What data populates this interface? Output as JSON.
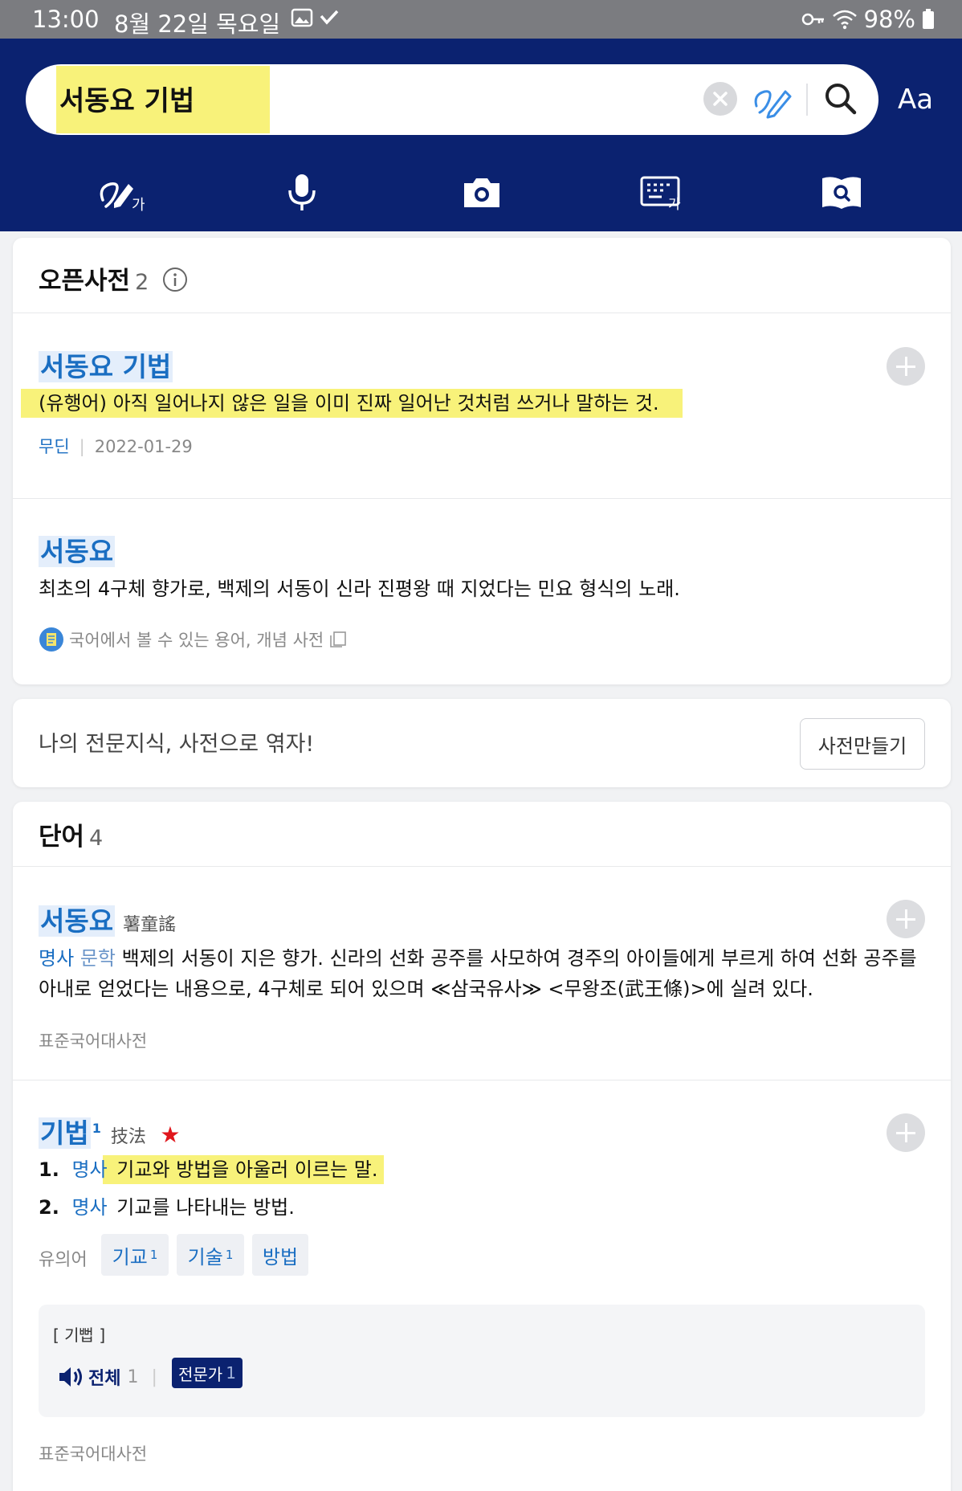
{
  "status_bar": {
    "time": "13:00",
    "date": "8월 22일 목요일",
    "battery": "98%"
  },
  "search": {
    "query": "서동요 기법",
    "font_button": "Aa"
  },
  "tools": [
    "handwriting-icon",
    "microphone-icon",
    "camera-icon",
    "keyboard-icon",
    "book-search-icon"
  ],
  "open_dict": {
    "title": "오픈사전",
    "count": "2",
    "entries": [
      {
        "title": "서동요 기법",
        "definition": "(유행어) 아직 일어나지 않은 일을 이미 진짜 일어난 것처럼 쓰거나 말하는 것.",
        "author": "무딘",
        "date": "2022-01-29"
      },
      {
        "title": "서동요",
        "definition": "최초의 4구체 향가로, 백제의 서동이 신라 진평왕 때 지었다는 민요 형식의 노래.",
        "source": "국어에서 볼 수 있는 용어, 개념 사전"
      }
    ]
  },
  "promo": {
    "text": "나의 전문지식, 사전으로 엮자!",
    "button": "사전만들기"
  },
  "words": {
    "title": "단어",
    "count": "4",
    "entries": [
      {
        "title": "서동요",
        "hanja": "薯童謠",
        "pos": "명사",
        "field": "문학",
        "def_line1": "백제의 서동이 지은 향가. 신라의 선화 공주를 사모하여 경주의 아이들에게 부르게 하여 선화 공주를",
        "def_line2": "아내로 얻었다는 내용으로, 4구체로 되어 있으며 ≪삼국유사≫ <무왕조(武王條)>에 실려 있다.",
        "source": "표준국어대사전"
      },
      {
        "title": "기법",
        "superscript": "1",
        "hanja": "技法",
        "senses": [
          {
            "num": "1.",
            "pos": "명사",
            "text": "기교와 방법을 아울러 이르는 말."
          },
          {
            "num": "2.",
            "pos": "명사",
            "text": "기교를 나타내는 방법."
          }
        ],
        "synonym_label": "유의어",
        "synonyms": [
          {
            "word": "기교",
            "sup": "1"
          },
          {
            "word": "기술",
            "sup": "1"
          },
          {
            "word": "방법",
            "sup": ""
          }
        ],
        "pronunciation": "[ 기뻡 ]",
        "audio_all_label": "전체",
        "audio_all_count": "1",
        "expert_label": "전문가",
        "expert_count": "1",
        "source": "표준국어대사전"
      }
    ]
  },
  "colors": {
    "header": "#0b2270",
    "link": "#1a6ec2",
    "highlight": "#f8f27a",
    "star": "#e0161c"
  }
}
